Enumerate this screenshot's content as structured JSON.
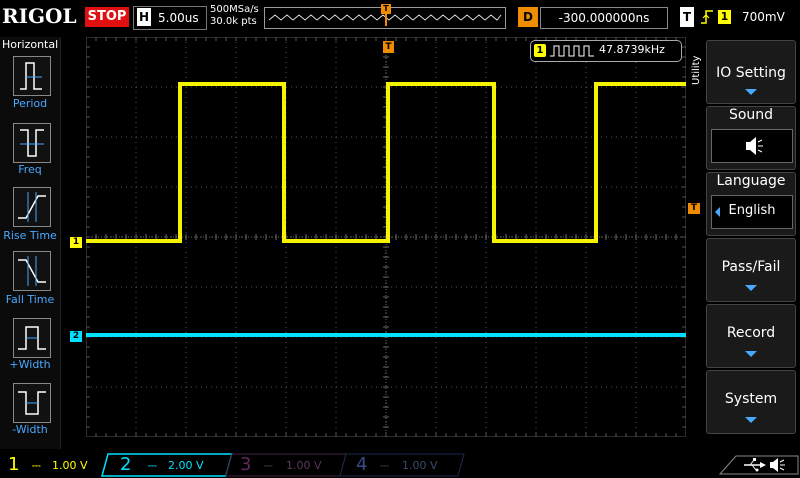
{
  "topbar": {
    "brand": "RIGOL",
    "run_state": "STOP",
    "timebase_letter": "H",
    "timebase_value": "5.00us",
    "sample_rate": "500MSa/s",
    "mem_depth": "30.0k pts",
    "trigger_marker": "T",
    "delay_letter": "D",
    "delay_value": "-300.000000ns",
    "trig_letter": "T",
    "trig_source": "1",
    "trig_level": "700mV"
  },
  "left_menu": {
    "title": "Horizontal",
    "items": [
      {
        "label": "Period"
      },
      {
        "label": "Freq"
      },
      {
        "label": "Rise Time"
      },
      {
        "label": "Fall Time"
      },
      {
        "label": "+Width"
      },
      {
        "label": "-Width"
      }
    ]
  },
  "measurement": {
    "channel": "1",
    "value": "47.8739kHz"
  },
  "markers": {
    "ch1": "1",
    "ch2": "2",
    "trig_top": "T",
    "trig_level": "T"
  },
  "right_menu": {
    "section": "Utility",
    "items": [
      {
        "label": "IO Setting"
      },
      {
        "label": "Sound"
      },
      {
        "label": "Language",
        "value": "English"
      },
      {
        "label": "Pass/Fail"
      },
      {
        "label": "Record"
      },
      {
        "label": "System"
      }
    ]
  },
  "channels": [
    {
      "num": "1",
      "scale": "1.00 V",
      "color": "#ffff00"
    },
    {
      "num": "2",
      "scale": "2.00 V",
      "color": "#00e5ff"
    },
    {
      "num": "3",
      "scale": "1.00 V",
      "color": "#b000b0"
    },
    {
      "num": "4",
      "scale": "1.00 V",
      "color": "#3050ff"
    }
  ],
  "colors": {
    "ch1": "#f4f400",
    "ch2": "#00e0ff",
    "accent": "#4aa8ff",
    "trigger": "#f08c00",
    "stop": "#e01010"
  },
  "icons": {
    "usb": "usb-icon",
    "speaker": "speaker-icon"
  }
}
